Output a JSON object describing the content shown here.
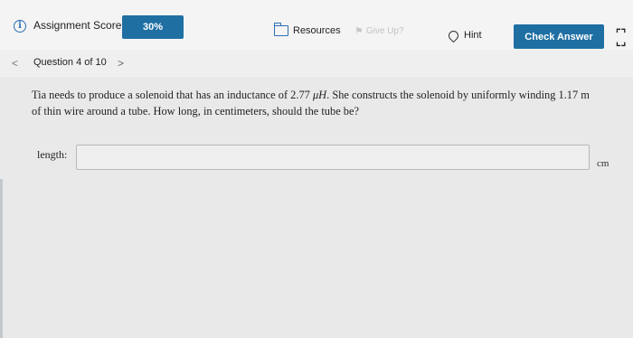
{
  "toolbar": {
    "score_label": "Assignment Score:",
    "score_value": "30%",
    "resources_label": "Resources",
    "give_up_label": "Give Up?",
    "hint_label": "Hint",
    "check_answer_label": "Check Answer"
  },
  "navigation": {
    "question_counter": "Question 4 of 10",
    "prev_symbol": "<",
    "next_symbol": ">"
  },
  "question": {
    "text_before": "Tia needs to produce a solenoid that has an inductance of 2.77 ",
    "unit_micro": "μH",
    "text_middle": ". She constructs the solenoid by uniformly winding 1.17 m",
    "text_after": "of thin wire around a tube. How long, in centimeters, should the tube be?"
  },
  "answer": {
    "label": "length:",
    "value": "",
    "unit": "cm"
  },
  "colors": {
    "accent": "#1f6fa3",
    "icon_blue": "#2d6fb3",
    "background": "#e9e9e9"
  },
  "icons": {
    "info": "info-circle-icon",
    "resources": "folder-icon",
    "give_up": "flag-icon",
    "hint": "lightbulb-icon",
    "expand": "expand-icon"
  }
}
